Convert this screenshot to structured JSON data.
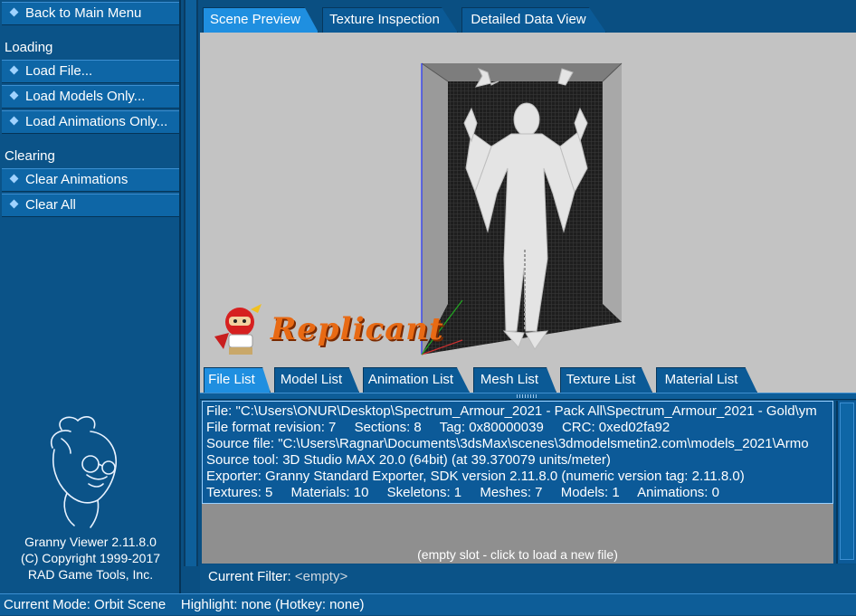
{
  "sidebar": {
    "back_label": "Back to Main Menu",
    "loading_heading": "Loading",
    "loading_items": [
      "Load File...",
      "Load Models Only...",
      "Load Animations Only..."
    ],
    "clearing_heading": "Clearing",
    "clearing_items": [
      "Clear Animations",
      "Clear All"
    ],
    "credits": [
      "Granny Viewer 2.11.8.0",
      "(C) Copyright 1999-2017",
      "RAD Game Tools, Inc."
    ]
  },
  "top_tabs": [
    "Scene Preview",
    "Texture Inspection",
    "Detailed Data View"
  ],
  "top_tab_active": 0,
  "viewport": {
    "logo_text": "Replicant"
  },
  "bottom_tabs": [
    "File List",
    "Model List",
    "Animation List",
    "Mesh List",
    "Texture List",
    "Material List"
  ],
  "bottom_tab_active": 0,
  "file_info": {
    "file": "File: \"C:\\Users\\ONUR\\Desktop\\Spectrum_Armour_2021 - Pack All\\Spectrum_Armour_2021 - Gold\\ym",
    "format_revision": "File format revision: 7",
    "sections": "Sections: 8",
    "tag": "Tag: 0x80000039",
    "crc": "CRC: 0xed02fa92",
    "source_file": "Source file: \"C:\\Users\\Ragnar\\Documents\\3dsMax\\scenes\\3dmodelsmetin2.com\\models_2021\\Armo",
    "source_tool": "Source tool: 3D Studio MAX 20.0 (64bit) (at 39.370079 units/meter)",
    "exporter": "Exporter: Granny Standard Exporter, SDK version 2.11.8.0 (numeric version tag: 2.11.8.0)",
    "textures": "Textures: 5",
    "materials": "Materials: 10",
    "skeletons": "Skeletons: 1",
    "meshes": "Meshes: 7",
    "models": "Models: 1",
    "animations": "Animations: 0"
  },
  "empty_slot_label": "(empty slot - click to load a new file)",
  "filter": {
    "label": "Current Filter:",
    "value": "<empty>"
  },
  "status": {
    "mode": "Current Mode: Orbit Scene",
    "highlight": "Highlight: none (Hotkey: none)"
  },
  "colors": {
    "panel_blue": "#0b5388",
    "active_tab": "#1f8fe0",
    "viewport_gray": "#c3c3c3",
    "logo_orange": "#e86a14"
  }
}
